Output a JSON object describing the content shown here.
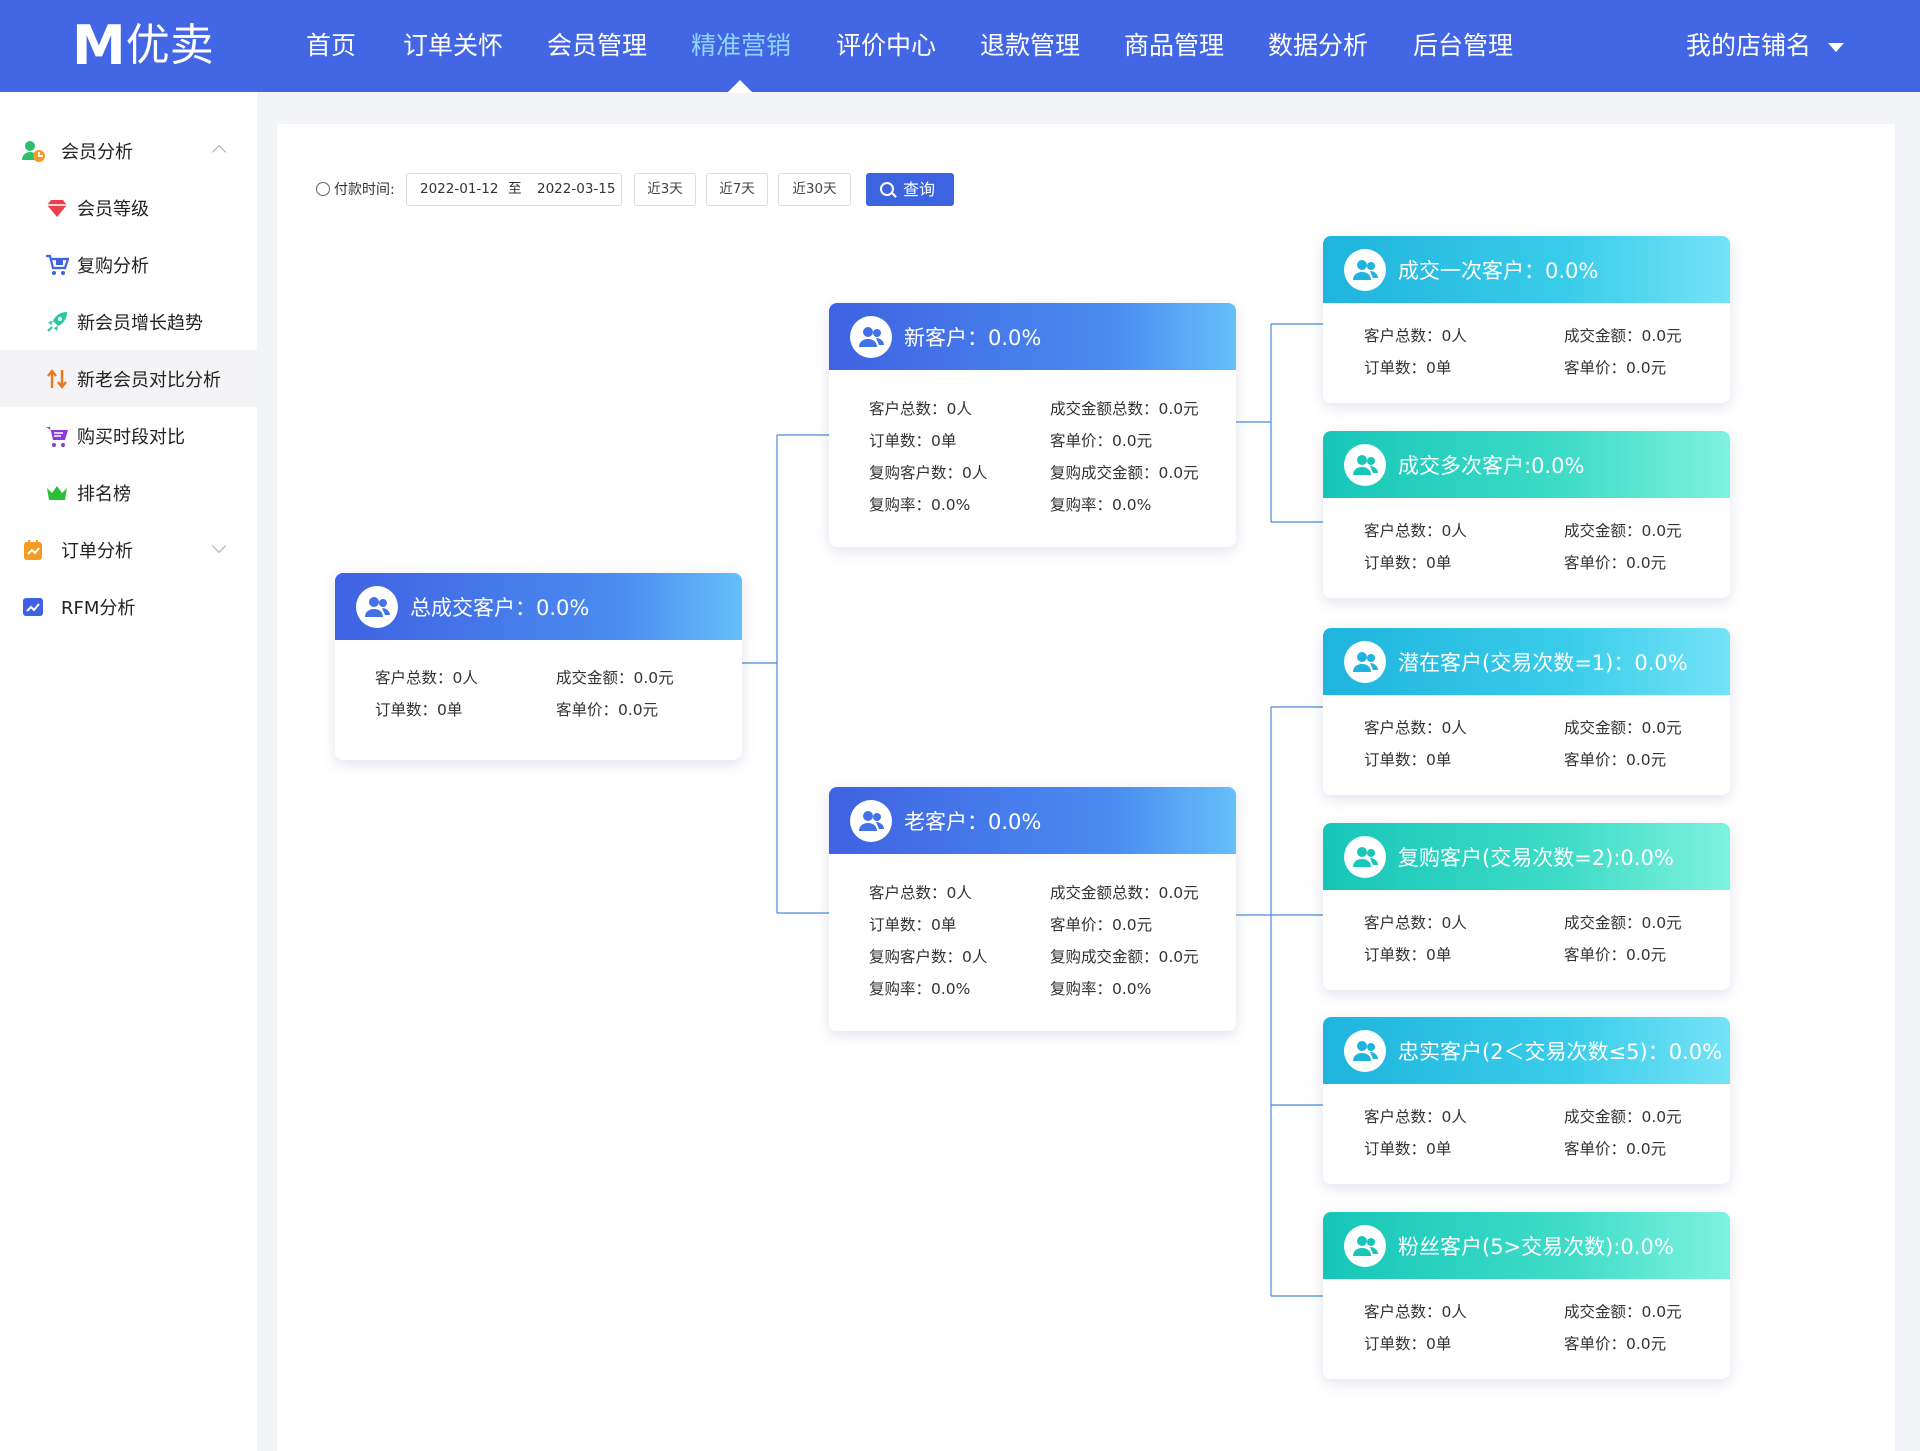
{
  "brand": {
    "logo_letter": "M",
    "logo_name": "优卖"
  },
  "nav": {
    "items": [
      "首页",
      "订单关怀",
      "会员管理",
      "精准营销",
      "评价中心",
      "退款管理",
      "商品管理",
      "数据分析",
      "后台管理"
    ],
    "active_index": 3,
    "store_name": "我的店铺名"
  },
  "sidebar": {
    "groups": [
      {
        "label": "会员分析",
        "icon": "member-analysis-icon",
        "expanded": true
      },
      {
        "label": "订单分析",
        "icon": "order-analysis-icon",
        "expanded": false
      },
      {
        "label": "RFM分析",
        "icon": "rfm-chart-icon"
      }
    ],
    "items": [
      {
        "label": "会员等级",
        "icon": "diamond-icon"
      },
      {
        "label": "复购分析",
        "icon": "cart-repeat-icon"
      },
      {
        "label": "新会员增长趋势",
        "icon": "rocket-icon"
      },
      {
        "label": "新老会员对比分析",
        "icon": "up-down-arrows-icon",
        "active": true
      },
      {
        "label": "购买时段对比",
        "icon": "cart-icon"
      },
      {
        "label": "排名榜",
        "icon": "crown-icon"
      }
    ]
  },
  "filter": {
    "label": "付款时间:",
    "start_date": "2022-01-12",
    "separator": "至",
    "end_date": "2022-03-15",
    "quick_buttons": [
      "近3天",
      "近7天",
      "近30天"
    ],
    "query_label": "查询"
  },
  "cards": {
    "total": {
      "title": "总成交客户：0.0%",
      "stats": [
        "客户总数：0人",
        "成交金额：0.0元",
        "订单数：0单",
        "客单价：0.0元"
      ]
    },
    "new": {
      "title": "新客户：0.0%",
      "stats": [
        "客户总数：0人",
        "成交金额总数：0.0元",
        "订单数：0单",
        "客单价：0.0元",
        "复购客户数：0人",
        "复购成交金额：0.0元",
        "复购率：0.0%",
        "复购率：0.0%"
      ]
    },
    "old": {
      "title": "老客户：0.0%",
      "stats": [
        "客户总数：0人",
        "成交金额总数：0.0元",
        "订单数：0单",
        "客单价：0.0元",
        "复购客户数：0人",
        "复购成交金额：0.0元",
        "复购率：0.0%",
        "复购率：0.0%"
      ]
    },
    "once": {
      "title": "成交一次客户：0.0%",
      "stats": [
        "客户总数：0人",
        "成交金额：0.0元",
        "订单数：0单",
        "客单价：0.0元"
      ]
    },
    "multi": {
      "title": "成交多次客户:0.0%",
      "stats": [
        "客户总数：0人",
        "成交金额：0.0元",
        "订单数：0单",
        "客单价：0.0元"
      ]
    },
    "potential": {
      "title": "潜在客户(交易次数=1)：0.0%",
      "stats": [
        "客户总数：0人",
        "成交金额：0.0元",
        "订单数：0单",
        "客单价：0.0元"
      ]
    },
    "repeat": {
      "title": "复购客户(交易次数=2):0.0%",
      "stats": [
        "客户总数：0人",
        "成交金额：0.0元",
        "订单数：0单",
        "客单价：0.0元"
      ]
    },
    "loyal": {
      "title": "忠实客户(2＜交易次数≤5)：0.0%",
      "stats": [
        "客户总数：0人",
        "成交金额：0.0元",
        "订单数：0单",
        "客单价：0.0元"
      ]
    },
    "fan": {
      "title": "粉丝客户(5>交易次数):0.0%",
      "stats": [
        "客户总数：0人",
        "成交金额：0.0元",
        "订单数：0单",
        "客单价：0.0元"
      ]
    }
  },
  "colors": {
    "nav_bg": "#4367e4",
    "nav_active": "#8fd4ff",
    "query_btn": "#3d64e0",
    "connector": "#4a88e0"
  }
}
